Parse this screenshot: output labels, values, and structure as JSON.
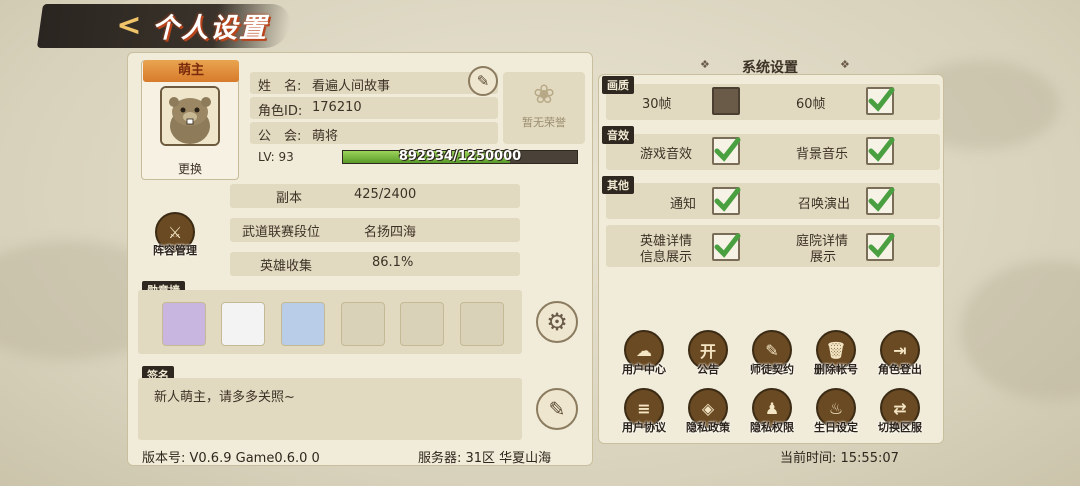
{
  "header": {
    "title": "个人设置",
    "back_glyph": "<"
  },
  "profile": {
    "tag": "萌主",
    "change_label": "更换",
    "name_label": "姓　名:",
    "name_value": "看遍人间故事",
    "id_label": "角色ID:",
    "id_value": "176210",
    "guild_label": "公　会:",
    "guild_value": "萌将",
    "level": "LV: 93",
    "exp_text": "892934/1250000",
    "exp_fraction": 0.714,
    "honor": "暂无荣誉"
  },
  "stats": [
    {
      "label": "副本",
      "value": "425/2400"
    },
    {
      "label": "武道联赛段位",
      "value": "名扬四海"
    },
    {
      "label": "英雄收集",
      "value": "86.1%"
    }
  ],
  "lineup_button": "阵容管理",
  "medal_wall": {
    "title": "勋章墙"
  },
  "signature": {
    "title": "签名",
    "text": "新人萌主，请多多关照~"
  },
  "footer": {
    "version": "版本号: V0.6.9 Game0.6.0 0",
    "server": "服务器: 31区 华夏山海",
    "time": "当前时间: 15:55:07"
  },
  "settings": {
    "title": "系统设置",
    "sections": {
      "quality": "画质",
      "sound": "音效",
      "other": "其他"
    },
    "items": {
      "fps30": {
        "label": "30帧",
        "checked": false
      },
      "fps60": {
        "label": "60帧",
        "checked": true
      },
      "game_sfx": {
        "label": "游戏音效",
        "checked": true
      },
      "bgm": {
        "label": "背景音乐",
        "checked": true
      },
      "notify": {
        "label": "通知",
        "checked": true
      },
      "summon": {
        "label": "召唤演出",
        "checked": true
      },
      "hero_detail": {
        "label1": "英雄详情",
        "label2": "信息展示",
        "checked": true
      },
      "yard_detail": {
        "label1": "庭院详情",
        "label2": "展示",
        "checked": true
      }
    }
  },
  "actions": [
    {
      "label": "用户中心",
      "glyph": "☁"
    },
    {
      "label": "公告",
      "glyph": "开"
    },
    {
      "label": "师徒契约",
      "glyph": "✎"
    },
    {
      "label": "删除帐号",
      "glyph": "🗑"
    },
    {
      "label": "角色登出",
      "glyph": "⇥"
    },
    {
      "label": "用户协议",
      "glyph": "≡"
    },
    {
      "label": "隐私政策",
      "glyph": "◈"
    },
    {
      "label": "隐私权限",
      "glyph": "♟"
    },
    {
      "label": "生日设定",
      "glyph": "♨"
    },
    {
      "label": "切换区服",
      "glyph": "⇄"
    }
  ]
}
